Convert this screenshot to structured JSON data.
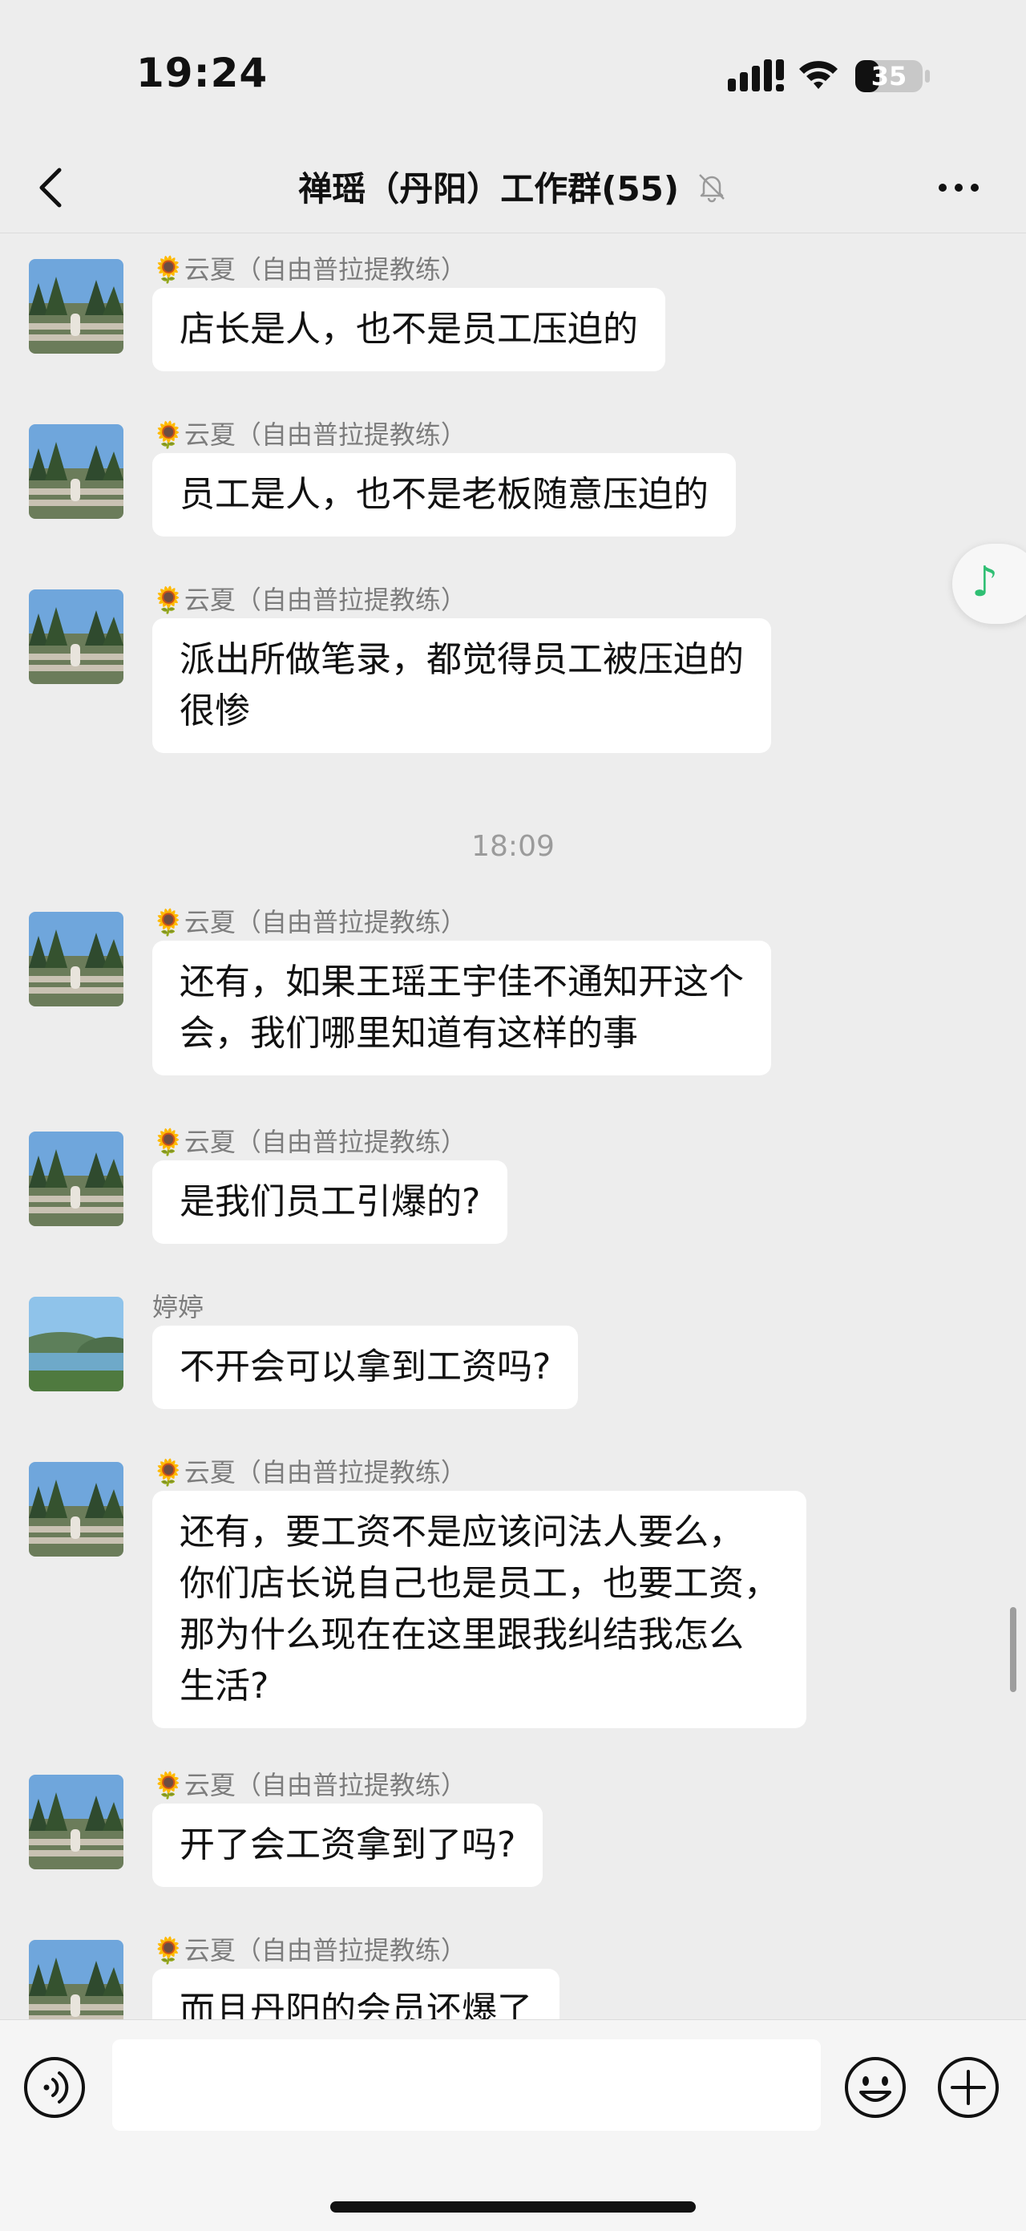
{
  "status": {
    "time": "19:24",
    "battery": "35"
  },
  "nav": {
    "title": "禅瑶（丹阳）工作群(55)"
  },
  "time_separator": "18:09",
  "messages": [
    {
      "sender_emoji": "🌻",
      "sender": "云夏（自由普拉提教练）",
      "text": "店长是人，也不是员工压迫的"
    },
    {
      "sender_emoji": "🌻",
      "sender": "云夏（自由普拉提教练）",
      "text": "员工是人，也不是老板随意压迫的"
    },
    {
      "sender_emoji": "🌻",
      "sender": "云夏（自由普拉提教练）",
      "text": "派出所做笔录，都觉得员工被压迫的\n很惨"
    },
    {
      "sender_emoji": "🌻",
      "sender": "云夏（自由普拉提教练）",
      "text": "还有，如果王瑶王宇佳不通知开这个\n会，我们哪里知道有这样的事"
    },
    {
      "sender_emoji": "🌻",
      "sender": "云夏（自由普拉提教练）",
      "text": "是我们员工引爆的?"
    },
    {
      "sender_emoji": "",
      "sender": "婷婷",
      "text": "不开会可以拿到工资吗?"
    },
    {
      "sender_emoji": "🌻",
      "sender": "云夏（自由普拉提教练）",
      "text": "还有，要工资不是应该问法人要么，\n你们店长说自己也是员工，也要工资，\n那为什么现在在这里跟我纠结我怎么\n生活?"
    },
    {
      "sender_emoji": "🌻",
      "sender": "云夏（自由普拉提教练）",
      "text": "开了会工资拿到了吗?"
    },
    {
      "sender_emoji": "🌻",
      "sender": "云夏（自由普拉提教练）",
      "text": "而且丹阳的会员还爆了"
    }
  ]
}
